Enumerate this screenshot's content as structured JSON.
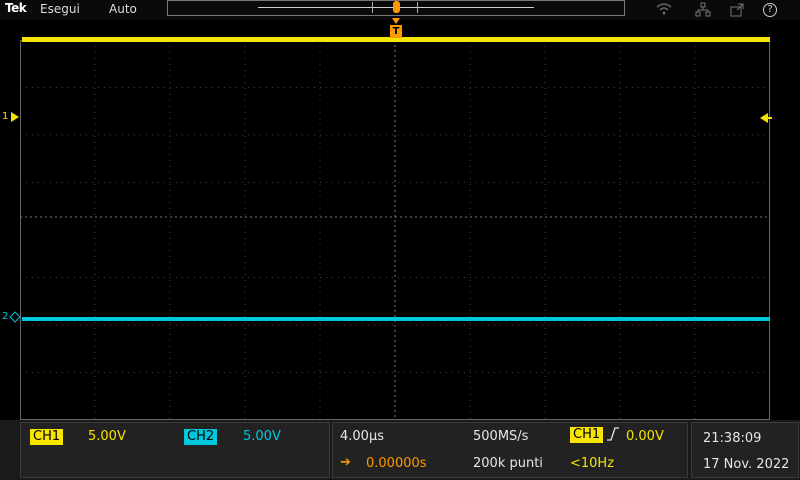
{
  "topbar": {
    "brand": "Tek",
    "run_state": "Esegui",
    "acq_mode": "Auto",
    "icons": [
      "wifi-icon",
      "network-icon",
      "export-icon",
      "help-icon"
    ],
    "help_glyph": "?"
  },
  "trigger": {
    "marker": "T"
  },
  "channels": {
    "ch1": {
      "label": "CH1",
      "number": "1",
      "scale": "5.00V",
      "color": "#f5e500"
    },
    "ch2": {
      "label": "CH2",
      "number": "2",
      "scale": "5.00V",
      "color": "#00c8dc"
    }
  },
  "horizontal": {
    "scale": "4.00µs",
    "position": "0.00000s",
    "sample_rate": "500MS/s",
    "record_length": "200k punti"
  },
  "trigger_panel": {
    "source": "CH1",
    "level": "0.00V",
    "freq": "<10Hz"
  },
  "clock": {
    "time": "21:38:09",
    "date": "17 Nov. 2022"
  }
}
